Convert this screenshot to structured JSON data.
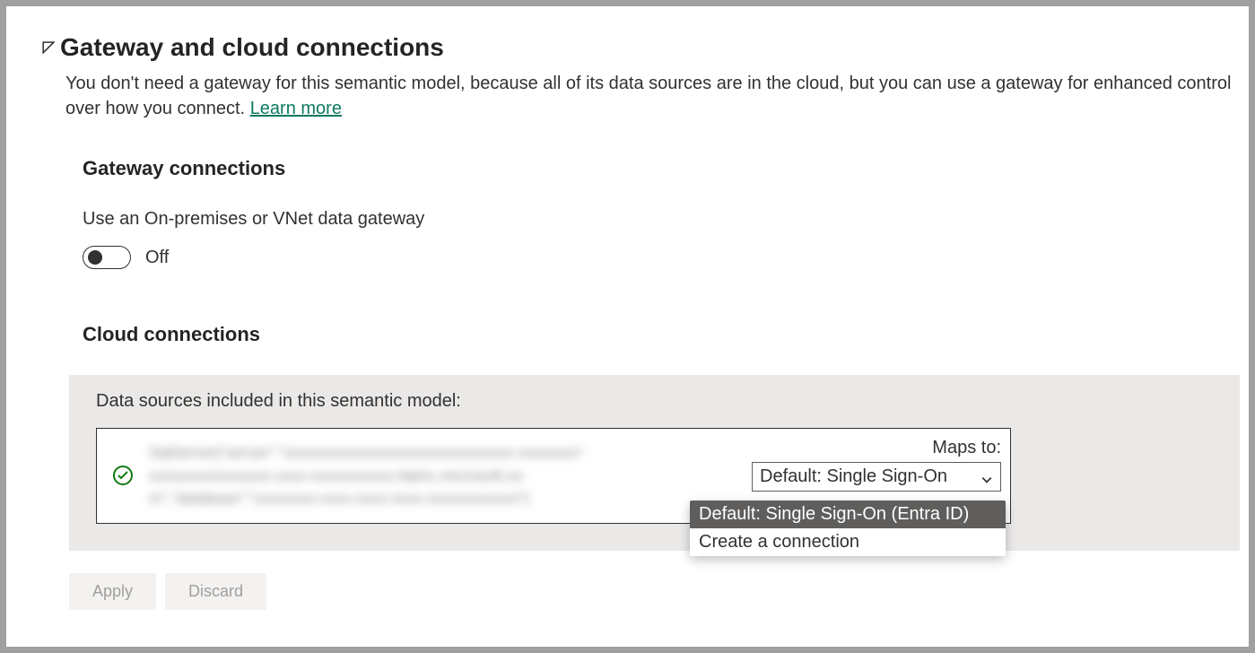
{
  "header": {
    "title": "Gateway and cloud connections",
    "description": "You don't need a gateway for this semantic model, because all of its data sources are in the cloud, but you can use a gateway for enhanced control over how you connect. ",
    "learn_more": "Learn more"
  },
  "gateway": {
    "heading": "Gateway connections",
    "toggle_label": "Use an On-premises or VNet data gateway",
    "toggle_state": "Off"
  },
  "cloud": {
    "heading": "Cloud connections",
    "data_sources_title": "Data sources included in this semantic model:",
    "maps_to_label": "Maps to:",
    "dropdown_selected": "Default: Single Sign-On",
    "dropdown_options": [
      "Default: Single Sign-On (Entra ID)",
      "Create a connection"
    ],
    "redacted_source": "SqlServer{\"server\":\"xxxxxxxxxxxxxxxxxxxxxxxxxxxxxx-xxxxxxxx\" xxxxxxxxxxxxxxxx.xxxx-xxxxxxxxxxx.fabric.microsoft.co m\",\"database\":\"xxxxxxxx-xxxx-xxxx-xxxx-xxxxxxxxxxxx\"}"
  },
  "buttons": {
    "apply": "Apply",
    "discard": "Discard"
  }
}
